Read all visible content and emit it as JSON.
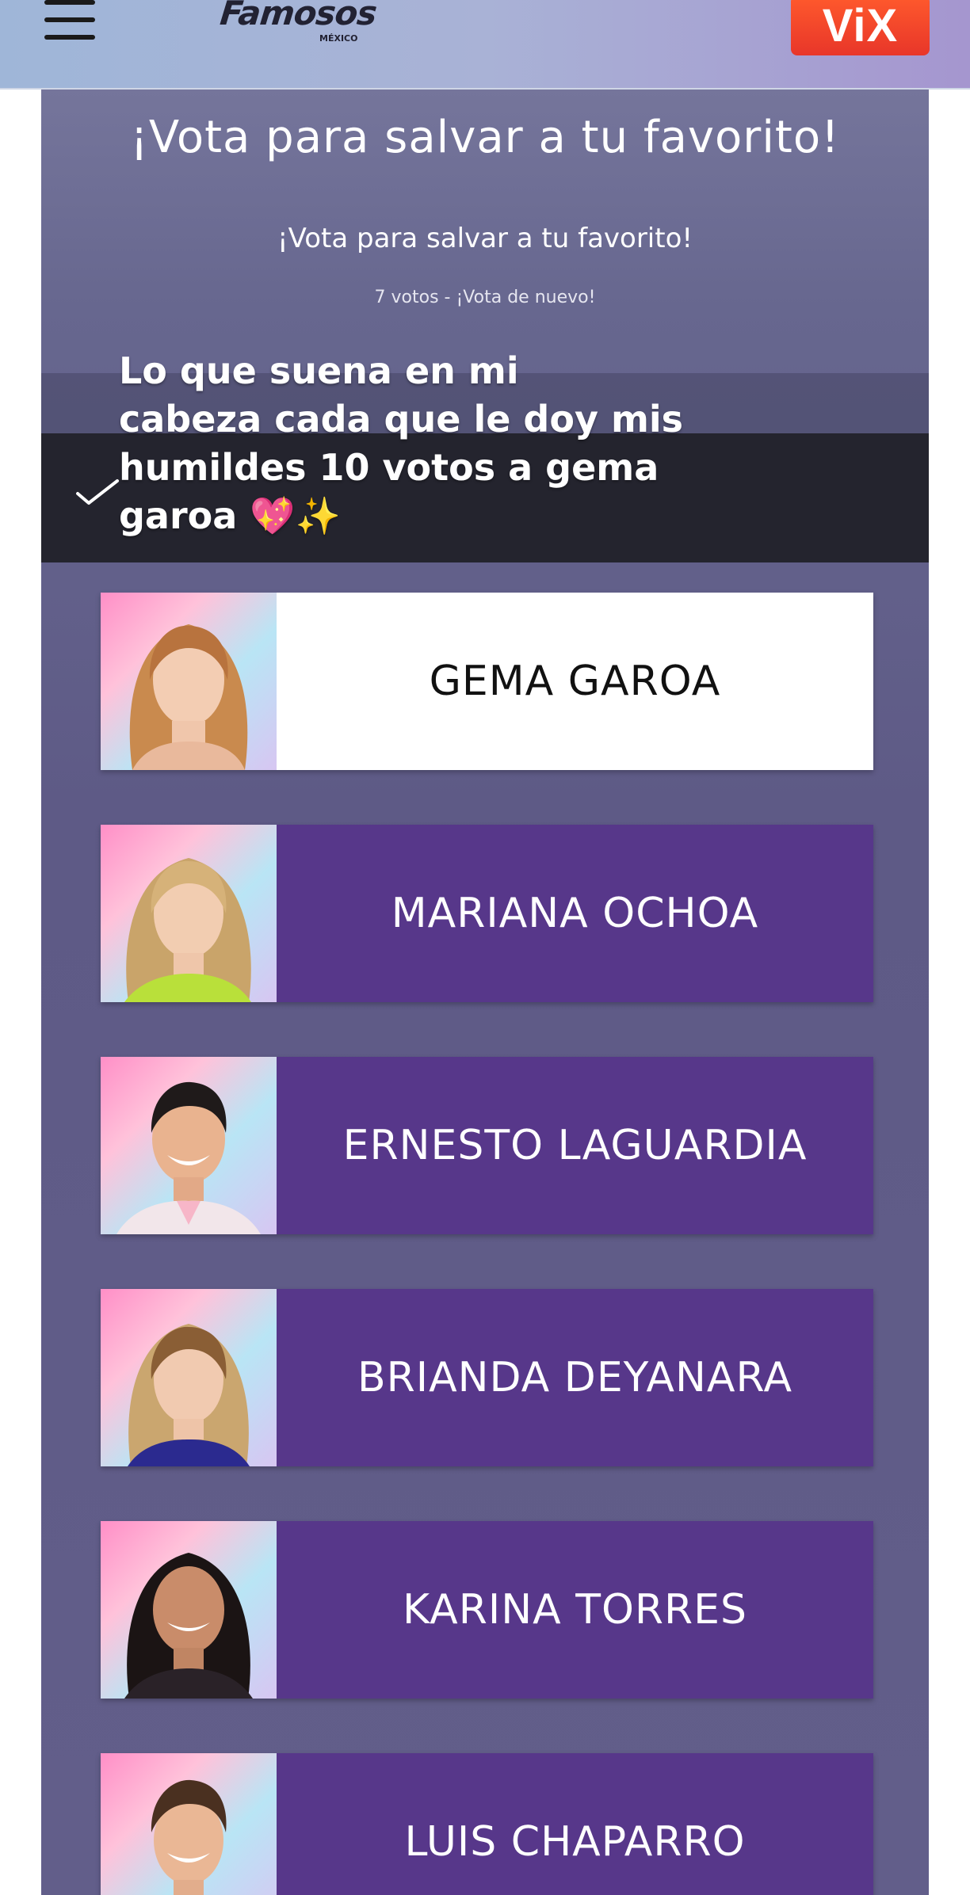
{
  "header": {
    "logo_text": "Famosos",
    "logo_sub": "MÉXICO",
    "vix_label": "ViX"
  },
  "panel": {
    "main_title": "¡Vota para salvar a tu favorito!",
    "sub_title": "¡Vota para salvar a tu favorito!",
    "vote_count": "7 votos - ¡Vota de nuevo!"
  },
  "caption": {
    "lines": [
      "Lo que suena en mi",
      "cabeza cada que le doy mis",
      "humildes 10 votos a gema",
      "garoa 💖✨"
    ]
  },
  "contestants": [
    {
      "name": "GEMA GAROA",
      "selected": true
    },
    {
      "name": "MARIANA OCHOA",
      "selected": false
    },
    {
      "name": "ERNESTO LAGUARDIA",
      "selected": false
    },
    {
      "name": "BRIANDA DEYANARA",
      "selected": false
    },
    {
      "name": "KARINA TORRES",
      "selected": false
    },
    {
      "name": "LUIS CHAPARRO",
      "selected": false
    }
  ],
  "colors": {
    "card_purple": "#57378a",
    "card_selected": "#ffffff",
    "vix_orange": "#ff5a2c"
  }
}
